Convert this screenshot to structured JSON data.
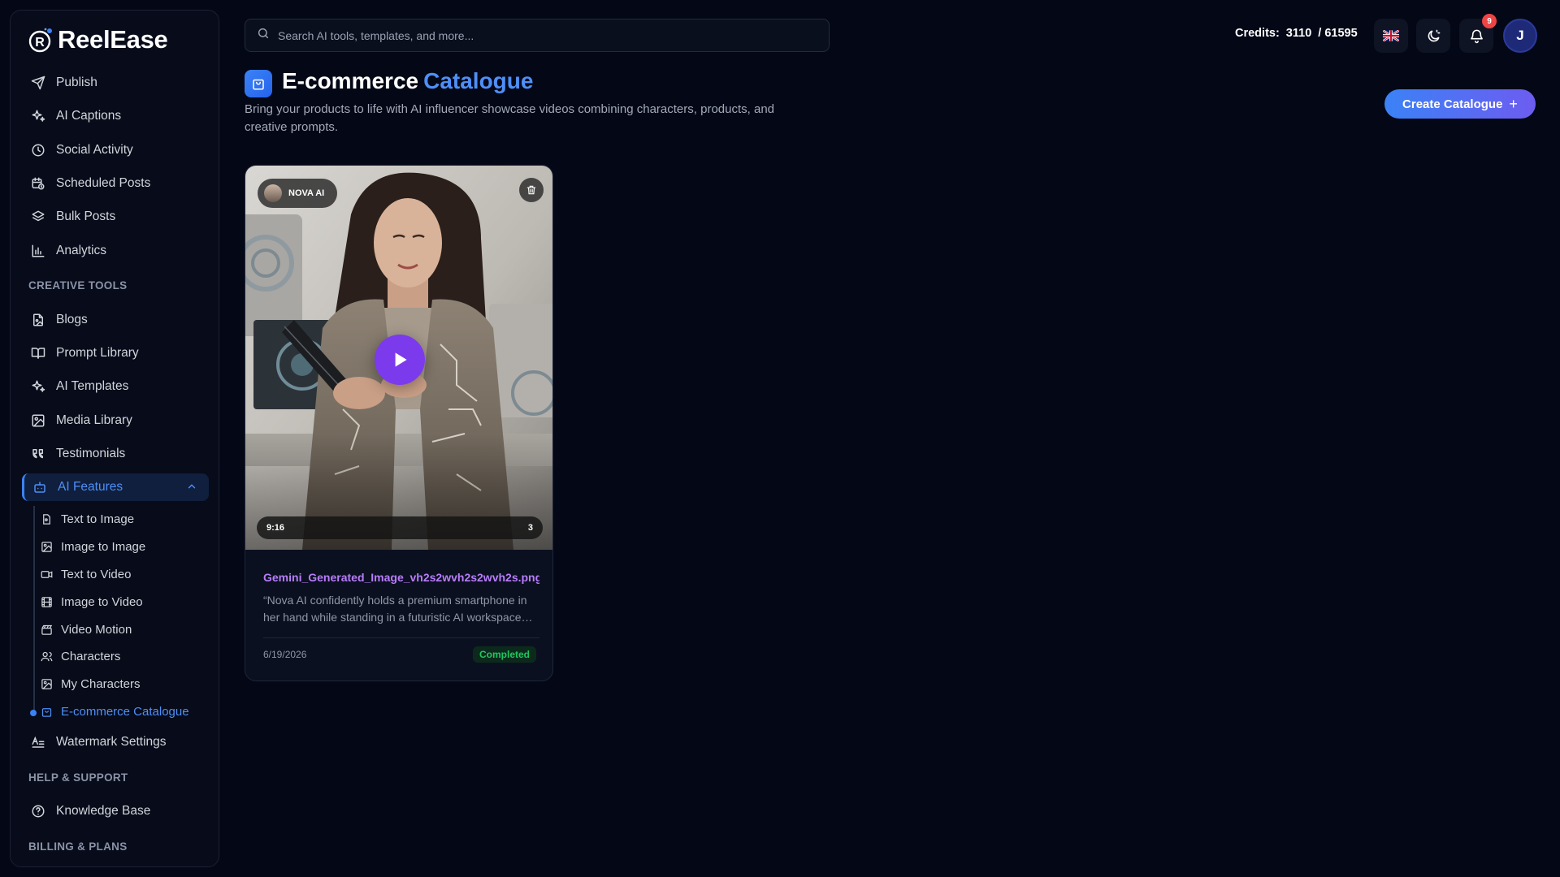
{
  "app": {
    "name": "ReelEase"
  },
  "sidebar": {
    "top_items": [
      {
        "label": "Publish"
      },
      {
        "label": "AI Captions"
      },
      {
        "label": "Social Activity"
      },
      {
        "label": "Scheduled Posts"
      },
      {
        "label": "Bulk Posts"
      },
      {
        "label": "Analytics"
      }
    ],
    "creative_title": "CREATIVE TOOLS",
    "creative_items": [
      {
        "label": "Blogs"
      },
      {
        "label": "Prompt Library"
      },
      {
        "label": "AI Templates"
      },
      {
        "label": "Media Library"
      },
      {
        "label": "Testimonials"
      },
      {
        "label": "AI Features"
      }
    ],
    "ai_sub_items": [
      {
        "label": "Text to Image"
      },
      {
        "label": "Image to Image"
      },
      {
        "label": "Text to Video"
      },
      {
        "label": "Image to Video"
      },
      {
        "label": "Video Motion"
      },
      {
        "label": "Characters"
      },
      {
        "label": "My Characters"
      },
      {
        "label": "E-commerce Catalogue"
      }
    ],
    "watermark_label": "Watermark Settings",
    "help_title": "HELP & SUPPORT",
    "kb_label": "Knowledge Base",
    "billing_title": "BILLING & PLANS"
  },
  "topbar": {
    "search_placeholder": "Search AI tools, templates, and more...",
    "credits_label": "Credits:",
    "credits_value": "3110  / 61595",
    "notifications_count": "9",
    "avatar_initial": "J"
  },
  "page": {
    "title": "E-commerce",
    "title_accent": "Catalogue",
    "description": "Bring your products to life with AI influencer showcase videos combining characters, products, and creative prompts.",
    "create_label": "Create Catalogue"
  },
  "cards": [
    {
      "character": "NOVA AI",
      "aspect": "9:16",
      "count": "3",
      "filename": "Gemini_Generated_Image_vh2s2wvh2s2wvh2s.png",
      "description": "“Nova AI confidently holds a premium smartphone in her hand while standing in a futuristic AI workspace…",
      "date": "6/19/2026",
      "status": "Completed"
    }
  ],
  "colors": {
    "accent": "#4f8ff7",
    "play": "#7c3aed",
    "status": "#22c55e",
    "filename": "#b87dfb"
  }
}
